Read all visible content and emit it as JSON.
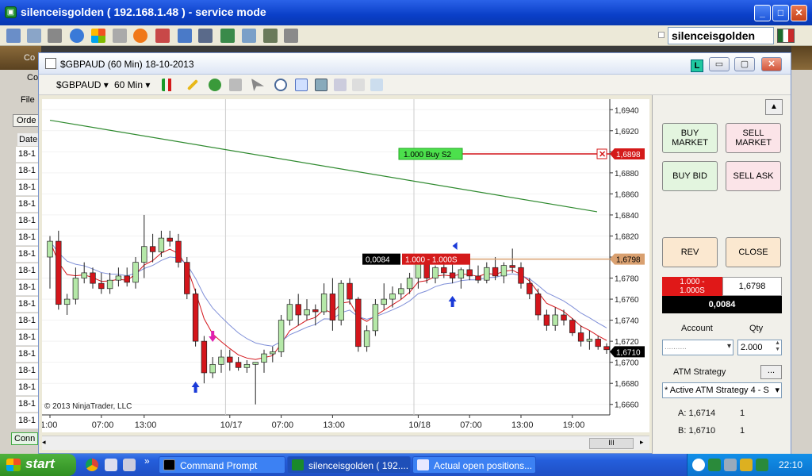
{
  "outer_window": {
    "title": "silenceisgolden ( 192.168.1.48 ) - service mode",
    "app_icon": "ninjatrader-icon",
    "controls": [
      "_",
      "□",
      "✕"
    ]
  },
  "outer_toolbar": {
    "user": "silenceisgolden"
  },
  "background_panel": {
    "labels": [
      "Co",
      "Co",
      "File",
      "Orde",
      "Date",
      "Conn"
    ],
    "rows": [
      "18-1",
      "18-1",
      "18-1",
      "18-1",
      "18-1",
      "18-1",
      "18-1",
      "18-1",
      "18-1",
      "18-1",
      "18-1",
      "18-1",
      "18-1",
      "18-1",
      "18-1",
      "18-1",
      "18-1"
    ]
  },
  "chart_window": {
    "title": "$GBPAUD (60 Min)  18-10-2013",
    "badge": "L",
    "instrument": "$GBPAUD",
    "interval": "60 Min",
    "copyright": "© 2013 NinjaTrader, LLC",
    "scroll_grip": "III"
  },
  "chart_data": {
    "type": "candlestick",
    "y_ticks": [
      "1,6940",
      "1,6920",
      "1,6900",
      "1,6880",
      "1,6860",
      "1,6840",
      "1,6820",
      "1,6800",
      "1,6780",
      "1,6760",
      "1,6740",
      "1,6720",
      "1,6700",
      "1,6680",
      "1,6660"
    ],
    "x_ticks": [
      "1:00",
      "07:00",
      "13:00",
      "10/17",
      "07:00",
      "13:00",
      "10/18",
      "07:00",
      "13:00",
      "19:00"
    ],
    "ylim": [
      1.665,
      1.695
    ],
    "candles": [
      [
        1.68,
        1.682,
        1.677,
        1.6815
      ],
      [
        1.6815,
        1.6825,
        1.675,
        1.6755
      ],
      [
        1.6755,
        1.6765,
        1.6745,
        1.676
      ],
      [
        1.676,
        1.679,
        1.6755,
        1.678
      ],
      [
        1.678,
        1.6795,
        1.6775,
        1.6785
      ],
      [
        1.6785,
        1.679,
        1.677,
        1.6775
      ],
      [
        1.6775,
        1.6785,
        1.6765,
        1.677
      ],
      [
        1.677,
        1.6785,
        1.6765,
        1.6778
      ],
      [
        1.6778,
        1.679,
        1.6772,
        1.6782
      ],
      [
        1.6782,
        1.679,
        1.6772,
        1.6776
      ],
      [
        1.6776,
        1.68,
        1.677,
        1.6795
      ],
      [
        1.6795,
        1.684,
        1.678,
        1.681
      ],
      [
        1.681,
        1.6822,
        1.6795,
        1.6805
      ],
      [
        1.6805,
        1.6825,
        1.68,
        1.6818
      ],
      [
        1.6818,
        1.6825,
        1.681,
        1.6815
      ],
      [
        1.6815,
        1.6822,
        1.679,
        1.6795
      ],
      [
        1.6795,
        1.68,
        1.676,
        1.6765
      ],
      [
        1.6765,
        1.677,
        1.6715,
        1.672
      ],
      [
        1.672,
        1.6725,
        1.668,
        1.669
      ],
      [
        1.669,
        1.6705,
        1.6685,
        1.6698
      ],
      [
        1.6698,
        1.6712,
        1.669,
        1.6705
      ],
      [
        1.6705,
        1.6712,
        1.6692,
        1.67
      ],
      [
        1.67,
        1.6705,
        1.6692,
        1.6695
      ],
      [
        1.6695,
        1.6702,
        1.669,
        1.6698
      ],
      [
        1.6698,
        1.67,
        1.666,
        1.67
      ],
      [
        1.67,
        1.6712,
        1.669,
        1.6708
      ],
      [
        1.6708,
        1.6715,
        1.67,
        1.671
      ],
      [
        1.671,
        1.6745,
        1.6705,
        1.674
      ],
      [
        1.674,
        1.676,
        1.6735,
        1.6755
      ],
      [
        1.6755,
        1.6765,
        1.6735,
        1.6745
      ],
      [
        1.6745,
        1.676,
        1.674,
        1.675
      ],
      [
        1.675,
        1.6755,
        1.6735,
        1.6748
      ],
      [
        1.6748,
        1.6775,
        1.6745,
        1.6765
      ],
      [
        1.6765,
        1.678,
        1.673,
        1.674
      ],
      [
        1.674,
        1.6778,
        1.6735,
        1.6775
      ],
      [
        1.6775,
        1.678,
        1.6755,
        1.676
      ],
      [
        1.676,
        1.6762,
        1.671,
        1.6715
      ],
      [
        1.6715,
        1.6735,
        1.671,
        1.673
      ],
      [
        1.673,
        1.676,
        1.6725,
        1.6755
      ],
      [
        1.6755,
        1.6775,
        1.675,
        1.676
      ],
      [
        1.676,
        1.6772,
        1.6752,
        1.6765
      ],
      [
        1.6765,
        1.6775,
        1.676,
        1.677
      ],
      [
        1.677,
        1.6785,
        1.6765,
        1.678
      ],
      [
        1.678,
        1.68,
        1.677,
        1.6796
      ],
      [
        1.6796,
        1.68,
        1.6775,
        1.678
      ],
      [
        1.678,
        1.6792,
        1.6775,
        1.679
      ],
      [
        1.679,
        1.6795,
        1.678,
        1.6785
      ],
      [
        1.6785,
        1.6795,
        1.6775,
        1.678
      ],
      [
        1.678,
        1.679,
        1.677,
        1.6788
      ],
      [
        1.6788,
        1.6796,
        1.6778,
        1.6782
      ],
      [
        1.6782,
        1.6792,
        1.6775,
        1.6778
      ],
      [
        1.6778,
        1.6795,
        1.6775,
        1.679
      ],
      [
        1.679,
        1.68,
        1.6778,
        1.6782
      ],
      [
        1.6782,
        1.6795,
        1.6775,
        1.6792
      ],
      [
        1.6792,
        1.6808,
        1.6785,
        1.679
      ],
      [
        1.679,
        1.6795,
        1.677,
        1.6775
      ],
      [
        1.6775,
        1.678,
        1.676,
        1.6765
      ],
      [
        1.6765,
        1.677,
        1.674,
        1.6745
      ],
      [
        1.6745,
        1.675,
        1.673,
        1.6735
      ],
      [
        1.6735,
        1.6752,
        1.673,
        1.6745
      ],
      [
        1.6745,
        1.675,
        1.6735,
        1.674
      ],
      [
        1.674,
        1.6742,
        1.6725,
        1.6728
      ],
      [
        1.6728,
        1.6735,
        1.6715,
        1.672
      ],
      [
        1.672,
        1.673,
        1.6712,
        1.6722
      ],
      [
        1.6722,
        1.6725,
        1.6712,
        1.6715
      ],
      [
        1.6715,
        1.6718,
        1.6708,
        1.6712
      ]
    ],
    "green_sma_start": 1.693,
    "green_sma_end": 1.6843,
    "buy_stop_price": 1.6898,
    "buy_stop_label": "1.000   Buy S2",
    "position_price": 1.6798,
    "position_pnl": "0,0084",
    "position_label": "1.000 - 1.000S",
    "last_price_label": "1,6710",
    "stop_price_label": "1,6898",
    "pos_price_label": "1,6798"
  },
  "side_panel": {
    "buy_market": "BUY\nMARKET",
    "sell_market": "SELL\nMARKET",
    "buy_bid": "BUY BID",
    "sell_ask": "SELL ASK",
    "rev": "REV",
    "close": "CLOSE",
    "position_qty": "1.000 -\n1.000S",
    "position_price": "1,6798",
    "pnl": "0,0084",
    "account_label": "Account",
    "qty_label": "Qty",
    "account_value": "..........",
    "qty_value": "2.000",
    "atm_label": "ATM Strategy",
    "atm_more": "...",
    "atm_value": "* Active ATM Strategy 4 - S",
    "ask_label": "A: 1,6714",
    "ask_qty": "1",
    "bid_label": "B: 1,6710",
    "bid_qty": "1"
  },
  "taskbar": {
    "start": "start",
    "tasks": [
      "Command Prompt",
      "silenceisgolden ( 192....",
      "Actual open positions..."
    ],
    "clock": "22:10",
    "overflow": "»"
  },
  "colors": {
    "candle_up": "#b5e8a8",
    "candle_down": "#d4151b",
    "ema_red": "#d4151b",
    "ema_blue": "#7f8fd8",
    "sma_green": "#2f8a2f",
    "buy_stop_line": "#d4151b",
    "position_line": "#d9a070"
  }
}
